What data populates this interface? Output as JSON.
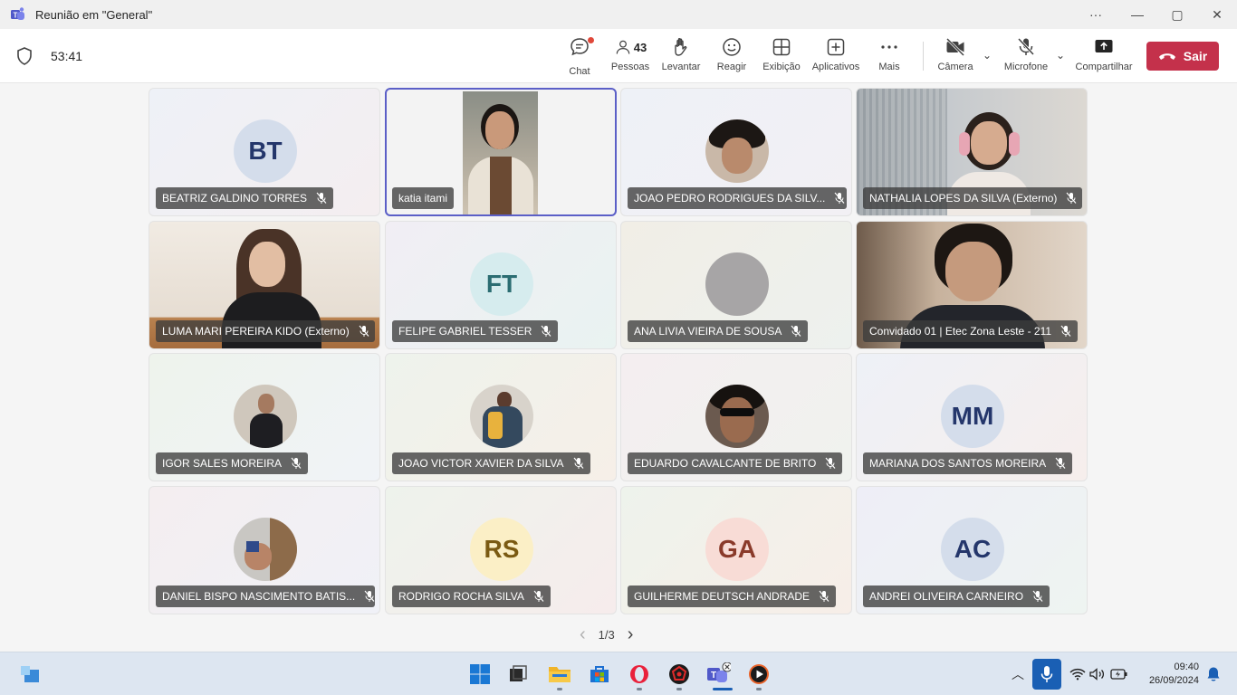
{
  "window": {
    "title": "Reunião em \"General\"",
    "controls": {
      "more": "···",
      "minimize": "—",
      "maximize": "▢",
      "close": "✕"
    }
  },
  "toolbar": {
    "timer": "53:41",
    "chat": "Chat",
    "people": "Pessoas",
    "people_count": "43",
    "raise": "Levantar",
    "react": "Reagir",
    "view": "Exibição",
    "apps": "Aplicativos",
    "more": "Mais",
    "camera": "Câmera",
    "mic": "Microfone",
    "share": "Compartilhar",
    "leave": "Sair",
    "leave_color": "#c4314b",
    "accent": "#5b5fc7"
  },
  "participants": [
    {
      "name": "BEATRIZ GALDINO TORRES",
      "initials": "BT"
    },
    {
      "name": "katia itami"
    },
    {
      "name": "JOAO PEDRO RODRIGUES DA SILV..."
    },
    {
      "name": "NATHALIA LOPES DA SILVA (Externo)"
    },
    {
      "name": "LUMA MARI PEREIRA KIDO (Externo)"
    },
    {
      "name": "FELIPE GABRIEL TESSER",
      "initials": "FT"
    },
    {
      "name": "ANA LIVIA VIEIRA DE SOUSA"
    },
    {
      "name": "Convidado 01 | Etec Zona Leste - 211"
    },
    {
      "name": "IGOR SALES MOREIRA"
    },
    {
      "name": "JOAO VICTOR XAVIER DA SILVA"
    },
    {
      "name": "EDUARDO CAVALCANTE DE BRITO"
    },
    {
      "name": "MARIANA DOS SANTOS MOREIRA",
      "initials": "MM"
    },
    {
      "name": "DANIEL BISPO NASCIMENTO BATIS..."
    },
    {
      "name": "RODRIGO ROCHA SILVA",
      "initials": "RS"
    },
    {
      "name": "GUILHERME DEUTSCH ANDRADE",
      "initials": "GA"
    },
    {
      "name": "ANDREI OLIVEIRA CARNEIRO",
      "initials": "AC"
    }
  ],
  "pager": {
    "label": "1/3",
    "prev": "‹",
    "next": "›"
  },
  "taskbar": {
    "time": "09:40",
    "date": "26/09/2024",
    "apps": [
      "start-icon",
      "task-view-icon",
      "file-explorer-icon",
      "store-icon",
      "opera-icon",
      "antivirus-icon",
      "teams-icon",
      "media-player-icon"
    ]
  }
}
